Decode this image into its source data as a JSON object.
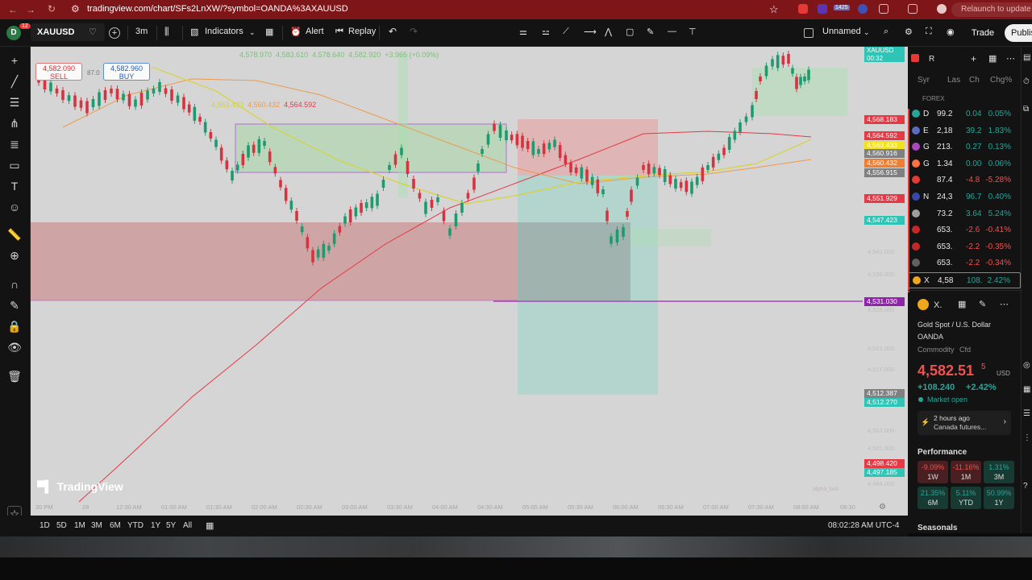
{
  "browser": {
    "url": "tradingview.com/chart/SFs2LnXW/?symbol=OANDA%3AXAUUSD",
    "relaunch_label": "Relaunch to update",
    "ext_badge": "1425"
  },
  "toolbar": {
    "avatar_letter": "D",
    "notif_count": "12",
    "symbol": "XAUUSD",
    "interval": "3m",
    "indicators_label": "Indicators",
    "alert_label": "Alert",
    "replay_label": "Replay",
    "layout_name": "Unnamed",
    "trade_label": "Trade",
    "publish_label": "Publis"
  },
  "chart": {
    "ohlc": [
      "4,578.970",
      "4,583.610",
      "4,578.640",
      "4,582.920",
      "+3.965 (+0.09%)"
    ],
    "sell_price": "4,582.090",
    "sell_label": "SELL",
    "spread": "87.0",
    "buy_price": "4,582.960",
    "buy_label": "BUY",
    "ma_values": [
      "4,563.433",
      "4,560.432",
      "4,564.592"
    ],
    "watermark": "TradingView",
    "credit": "alpha_bali",
    "price_labels": [
      {
        "text": "XAUUSD",
        "color": "#2ec4b6"
      },
      {
        "text": "4,582.920",
        "color": "#2ec4b6"
      },
      {
        "text": "00:32",
        "color": "#2ec4b6"
      },
      {
        "text": "4,568.183",
        "color": "#e53945"
      },
      {
        "text": "4,564.592",
        "color": "#e53945"
      },
      {
        "text": "4,563.433",
        "color": "#f5e11b"
      },
      {
        "text": "4,560.916",
        "color": "#808080"
      },
      {
        "text": "4,560.432",
        "color": "#ef7d32"
      },
      {
        "text": "4,556.915",
        "color": "#808080"
      },
      {
        "text": "4,551.929",
        "color": "#e53945"
      },
      {
        "text": "4,547.423",
        "color": "#2ec4b6"
      },
      {
        "text": "4,531.030",
        "color": "#8e24aa"
      },
      {
        "text": "4,512.387",
        "color": "#808080"
      },
      {
        "text": "4,512.270",
        "color": "#2ec4b6"
      },
      {
        "text": "4,498.420",
        "color": "#e53945"
      },
      {
        "text": "4,497.185",
        "color": "#2ec4b6"
      }
    ],
    "faded_prices": [
      "4,541.000",
      "4,536.000",
      "4,526.000",
      "4,521.000",
      "4,517.000",
      "4,507.000",
      "4,501.000",
      "4,494.000"
    ],
    "time_labels": [
      "20 PM",
      "28",
      "12:30 AM",
      "01:00 AM",
      "01:30 AM",
      "02:00 AM",
      "02:30 AM",
      "03:00 AM",
      "03:30 AM",
      "04:00 AM",
      "04:30 AM",
      "05:00 AM",
      "05:30 AM",
      "06:00 AM",
      "06:30 AM",
      "07:00 AM",
      "07:30 AM",
      "08:00 AM",
      "08:30"
    ]
  },
  "bottom": {
    "ranges": [
      "1D",
      "5D",
      "1M",
      "3M",
      "6M",
      "YTD",
      "1Y",
      "5Y",
      "All"
    ],
    "clock": "08:02:28 AM UTC-4"
  },
  "watchlist": {
    "title": "R",
    "columns": [
      "Syr",
      "Las",
      "Ch",
      "Chg%"
    ],
    "section": "FOREX",
    "rows": [
      {
        "sym": "D",
        "last": "99.2",
        "chg": "0.04",
        "chgp": "0.05%",
        "dir": "pos",
        "color": "#26a69a"
      },
      {
        "sym": "E",
        "last": "2,18",
        "chg": "39.2",
        "chgp": "1.83%",
        "dir": "pos",
        "color": "#5c6bc0"
      },
      {
        "sym": "G",
        "last": "213.",
        "chg": "0.27",
        "chgp": "0.13%",
        "dir": "pos",
        "color": "#ab47bc"
      },
      {
        "sym": "G",
        "last": "1.34",
        "chg": "0.00",
        "chgp": "0.06%",
        "dir": "pos",
        "color": "#ff7043"
      },
      {
        "sym": "",
        "last": "87.4",
        "chg": "-4.8",
        "chgp": "-5.28%",
        "dir": "neg",
        "color": "#e53935"
      },
      {
        "sym": "N",
        "last": "24,3",
        "chg": "96.7",
        "chgp": "0.40%",
        "dir": "pos",
        "color": "#3949ab"
      },
      {
        "sym": "",
        "last": "73.2",
        "chg": "3.64",
        "chgp": "5.24%",
        "dir": "pos",
        "color": "#9e9e9e"
      },
      {
        "sym": "",
        "last": "653.",
        "chg": "-2.6",
        "chgp": "-0.41%",
        "dir": "neg",
        "color": "#c62828"
      },
      {
        "sym": "",
        "last": "653.",
        "chg": "-2.2",
        "chgp": "-0.35%",
        "dir": "neg",
        "color": "#c62828"
      },
      {
        "sym": "",
        "last": "653.",
        "chg": "-2.2",
        "chgp": "-0.34%",
        "dir": "neg",
        "color": "#616161"
      },
      {
        "sym": "X",
        "last": "4,58",
        "chg": "108.",
        "chgp": "2.42%",
        "dir": "pos",
        "color": "#f0a71b"
      }
    ]
  },
  "details": {
    "symbol_short": "X.",
    "name": "Gold Spot / U.S. Dollar",
    "exchange": "OANDA",
    "category": "Commodity",
    "type": "Cfd",
    "price_main": "4,582.51",
    "price_sup": "5",
    "currency": "USD",
    "change": "+108.240",
    "change_pct": "+2.42%",
    "market_status": "Market open",
    "news_time": "2 hours ago",
    "news_text": "Canada futures...",
    "performance_title": "Performance",
    "performance": [
      {
        "value": "-9.09%",
        "label": "1W",
        "dir": "neg"
      },
      {
        "value": "-11.16%",
        "label": "1M",
        "dir": "neg"
      },
      {
        "value": "1.31%",
        "label": "3M",
        "dir": "pos"
      },
      {
        "value": "21.35%",
        "label": "6M",
        "dir": "pos"
      },
      {
        "value": "5.11%",
        "label": "YTD",
        "dir": "pos"
      },
      {
        "value": "50.99%",
        "label": "1Y",
        "dir": "pos"
      }
    ],
    "seasonals_title": "Seasonals"
  }
}
